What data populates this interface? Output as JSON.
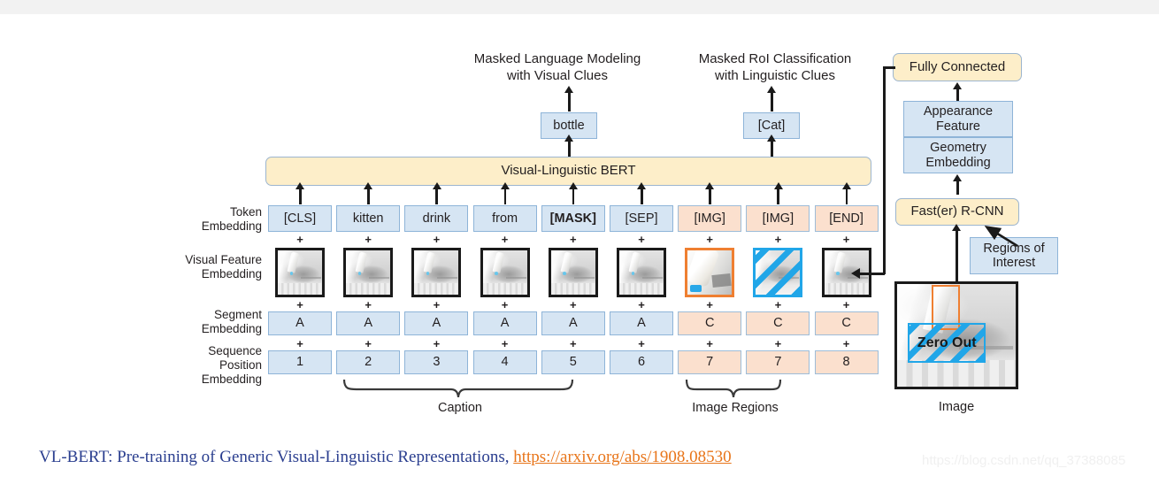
{
  "figure": {
    "tasks": [
      {
        "id": "mlm",
        "line1": "Masked Language Modeling",
        "line2": "with Visual Clues",
        "output": "bottle"
      },
      {
        "id": "mroi",
        "line1": "Masked RoI Classification",
        "line2": "with Linguistic Clues",
        "output": "[Cat]"
      }
    ],
    "backbone_label": "Visual-Linguistic BERT",
    "row_labels": {
      "token": "Token\nEmbedding",
      "token_l1": "Token",
      "token_l2": "Embedding",
      "visual_l1": "Visual Feature",
      "visual_l2": "Embedding",
      "segment_l1": "Segment",
      "segment_l2": "Embedding",
      "position_l1": "Sequence",
      "position_l2": "Position",
      "position_l3": "Embedding"
    },
    "plus_symbol": "+",
    "columns": [
      {
        "token": "[CLS]",
        "segment": "A",
        "position": "1",
        "type": "text",
        "thumb": "full",
        "bold": false
      },
      {
        "token": "kitten",
        "segment": "A",
        "position": "2",
        "type": "text",
        "thumb": "full",
        "bold": false
      },
      {
        "token": "drink",
        "segment": "A",
        "position": "3",
        "type": "text",
        "thumb": "full",
        "bold": false
      },
      {
        "token": "from",
        "segment": "A",
        "position": "4",
        "type": "text",
        "thumb": "full",
        "bold": false
      },
      {
        "token": "[MASK]",
        "segment": "A",
        "position": "5",
        "type": "text",
        "thumb": "full",
        "bold": true
      },
      {
        "token": "[SEP]",
        "segment": "A",
        "position": "6",
        "type": "text",
        "thumb": "full",
        "bold": false
      },
      {
        "token": "[IMG]",
        "segment": "C",
        "position": "7",
        "type": "region",
        "thumb": "crop",
        "bold": false
      },
      {
        "token": "[IMG]",
        "segment": "C",
        "position": "7",
        "type": "region",
        "thumb": "masked",
        "bold": false
      },
      {
        "token": "[END]",
        "segment": "C",
        "position": "8",
        "type": "region",
        "thumb": "full",
        "bold": false
      }
    ],
    "group_labels": {
      "caption": "Caption",
      "image_regions": "Image Regions"
    },
    "right_pipeline": {
      "fully_connected": "Fully Connected",
      "appearance_l1": "Appearance",
      "appearance_l2": "Feature",
      "geometry_l1": "Geometry",
      "geometry_l2": "Embedding",
      "detector": "Fast(er) R-CNN",
      "roi_l1": "Regions of",
      "roi_l2": "Interest",
      "image_caption": "Image",
      "zero_out": "Zero Out"
    },
    "citation": {
      "title": "VL-BERT: Pre-training of Generic Visual-Linguistic Representations,",
      "url": "https://arxiv.org/abs/1908.08530"
    },
    "watermark": "https://blog.csdn.net/qq_37388085",
    "colors": {
      "blue_fill": "#d6e5f3",
      "peach_fill": "#fbe0ce",
      "yellow_fill": "#fdeec9",
      "orange_accent": "#ef7f31",
      "cyan_accent": "#21a6e8",
      "text": "#231f20",
      "cite_title": "#2a3e8f",
      "cite_url": "#e8751a"
    }
  }
}
